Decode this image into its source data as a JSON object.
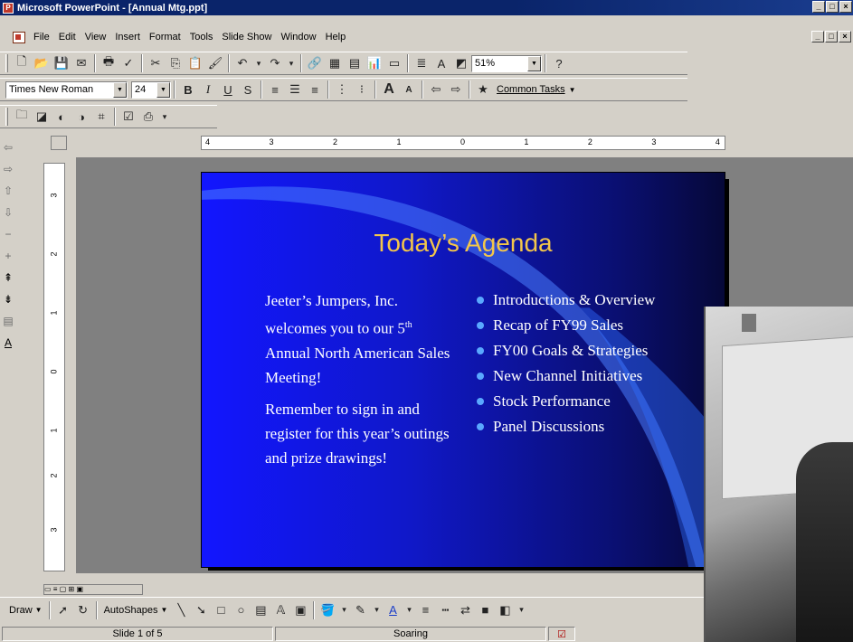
{
  "window": {
    "title": "Microsoft PowerPoint - [Annual Mtg.ppt]",
    "controls": [
      "_",
      "□",
      "×"
    ]
  },
  "menubar": {
    "items": [
      "File",
      "Edit",
      "View",
      "Insert",
      "Format",
      "Tools",
      "Slide Show",
      "Window",
      "Help"
    ],
    "mdi_controls": [
      "_",
      "□",
      "×"
    ]
  },
  "standard_toolbar": {
    "zoom": "51%",
    "icons": [
      "new-icon",
      "open-icon",
      "save-icon",
      "email-icon",
      "print-icon",
      "spelling-icon",
      "cut-icon",
      "copy-icon",
      "paste-icon",
      "format-painter-icon",
      "undo-icon",
      "redo-icon",
      "hyperlink-icon",
      "tables-borders-icon",
      "insert-table-icon",
      "insert-chart-icon",
      "new-slide-icon",
      "expand-all-icon",
      "show-formatting-icon",
      "grayscale-icon",
      "help-icon"
    ]
  },
  "formatting_toolbar": {
    "font": "Times New Roman",
    "size": "24",
    "bold": "B",
    "italic": "I",
    "underline": "U",
    "shadow": "S",
    "increase_font": "A",
    "decrease_font": "A",
    "common_tasks": "Common Tasks"
  },
  "outlining_toolbar": {
    "icons": [
      "promote-icon",
      "demote-icon",
      "move-up-icon",
      "move-down-icon",
      "collapse-icon",
      "expand-icon",
      "summary-slide-icon",
      "show-formatting-icon"
    ]
  },
  "ruler": {
    "h_labels": [
      "4",
      "3",
      "2",
      "1",
      "0",
      "1",
      "2",
      "3",
      "4"
    ],
    "v_labels": [
      "3",
      "2",
      "1",
      "0",
      "1",
      "2",
      "3"
    ]
  },
  "slide": {
    "title": "Today’s Agenda",
    "body_p1_a": "Jeeter’s Jumpers, Inc. welcomes you to our 5",
    "body_p1_sup": "th",
    "body_p1_b": " Annual North American Sales Meeting!",
    "body_p2": "Remember to sign in and register for this year’s outings and prize drawings!",
    "bullets": [
      "Introductions & Overview",
      "Recap of FY99 Sales",
      "FY00 Goals & Strategies",
      "New Channel Initiatives",
      "Stock Performance",
      "Panel Discussions"
    ],
    "bg_colors": [
      "#1216ff",
      "#060838"
    ],
    "title_color": "#f3c64a",
    "bullet_color": "#5aa8ff"
  },
  "drawing_toolbar": {
    "draw": "Draw",
    "autoshapes": "AutoShapes"
  },
  "status": {
    "slide": "Slide 1 of 5",
    "design": "Soaring"
  }
}
